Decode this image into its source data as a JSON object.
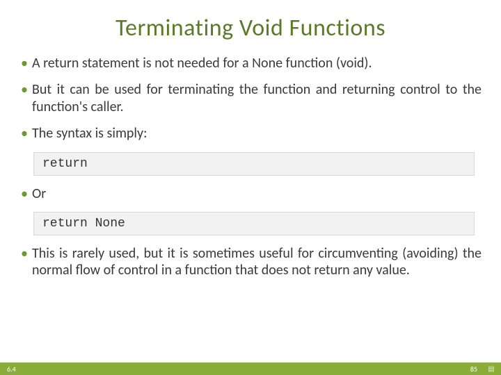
{
  "title": "Terminating Void Functions",
  "bullets": {
    "b1": "A return statement is not needed for a None function (void).",
    "b2": "But it can be used for terminating the function and returning control to the function's caller.",
    "b3": "The syntax is simply:",
    "b4": "Or",
    "b5": "This is rarely used, but it is sometimes useful for circumventing (avoiding) the normal flow of control in a function that does not return any value."
  },
  "code": {
    "c1": "return",
    "c2": "return None"
  },
  "footer": {
    "section": "6.4",
    "page": "85"
  }
}
